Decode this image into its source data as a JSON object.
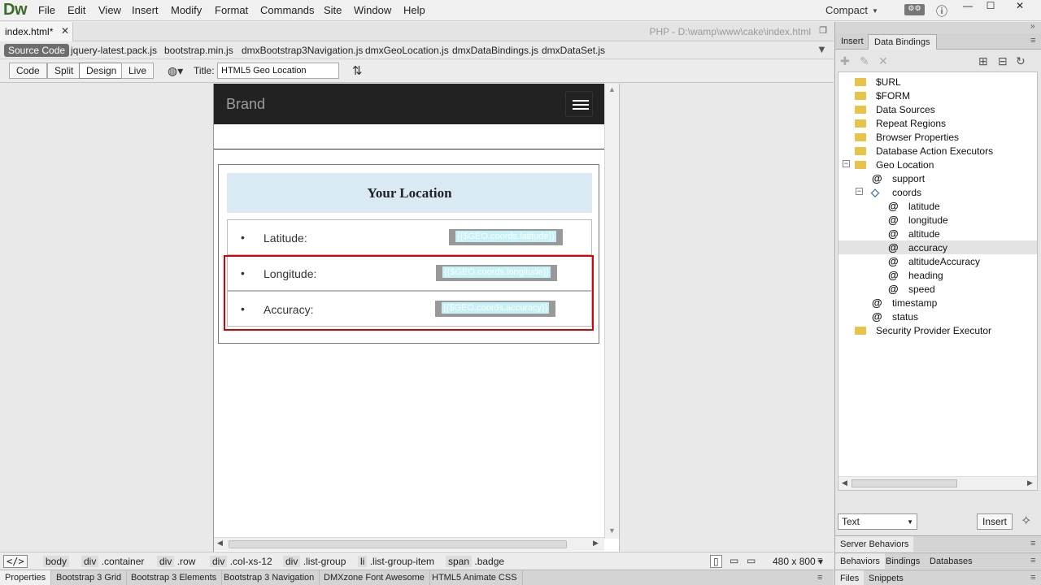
{
  "app": {
    "logo": "Dw",
    "menu": [
      "File",
      "Edit",
      "View",
      "Insert",
      "Modify",
      "Format",
      "Commands",
      "Site",
      "Window",
      "Help"
    ],
    "workspace": "Compact"
  },
  "document": {
    "tab_label": "index.html*",
    "path": "PHP - D:\\wamp\\www\\cake\\index.html",
    "related_files": [
      "Source Code",
      "jquery-latest.pack.js",
      "bootstrap.min.js",
      "dmxBootstrap3Navigation.js",
      "dmxGeoLocation.js",
      "dmxDataBindings.js",
      "dmxDataSet.js"
    ],
    "views": [
      "Code",
      "Split",
      "Design",
      "Live"
    ],
    "title_label": "Title:",
    "title_value": "HTML5 Geo Location"
  },
  "page": {
    "brand": "Brand",
    "panel_title": "Your Location",
    "items": [
      {
        "label": "Latitude:",
        "badge": "{{$GEO.coords.latitude}}"
      },
      {
        "label": "Longitude:",
        "badge": "{{$GEO.coords.longitude}}"
      },
      {
        "label": "Accuracy:",
        "badge": "{{$GEO.coords.accuracy}}"
      }
    ]
  },
  "tag_selector": {
    "tags": [
      {
        "name": "body",
        "cls": ""
      },
      {
        "name": "div",
        "cls": ".container"
      },
      {
        "name": "div",
        "cls": ".row"
      },
      {
        "name": "div",
        "cls": ".col-xs-12"
      },
      {
        "name": "div",
        "cls": ".list-group"
      },
      {
        "name": "li",
        "cls": ".list-group-item"
      },
      {
        "name": "span",
        "cls": ".badge"
      }
    ],
    "window_size": "480 x 800"
  },
  "bottom_tabs": [
    "Properties",
    "Bootstrap 3 Grid",
    "Bootstrap 3 Elements",
    "Bootstrap 3 Navigation",
    "DMXzone Font Awesome",
    "HTML5 Animate CSS"
  ],
  "right_panel": {
    "tabs": [
      "Insert",
      "Data Bindings"
    ],
    "tree": [
      {
        "label": "$URL"
      },
      {
        "label": "$FORM"
      },
      {
        "label": "Data Sources"
      },
      {
        "label": "Repeat Regions"
      },
      {
        "label": "Browser Properties"
      },
      {
        "label": "Database Action Executors"
      },
      {
        "label": "Geo Location"
      },
      {
        "label": "support"
      },
      {
        "label": "coords"
      },
      {
        "label": "latitude"
      },
      {
        "label": "longitude"
      },
      {
        "label": "altitude"
      },
      {
        "label": "accuracy"
      },
      {
        "label": "altitudeAccuracy"
      },
      {
        "label": "heading"
      },
      {
        "label": "speed"
      },
      {
        "label": "timestamp"
      },
      {
        "label": "status"
      },
      {
        "label": "Security Provider Executor"
      }
    ],
    "select_value": "Text",
    "insert_button": "Insert",
    "server_behaviors": "Server Behaviors",
    "section2_tabs": [
      "Behaviors",
      "Bindings",
      "Databases"
    ],
    "section3_tabs": [
      "Files",
      "Snippets"
    ]
  }
}
